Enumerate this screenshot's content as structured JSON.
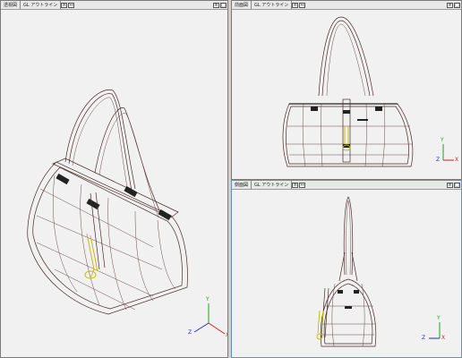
{
  "viewports": [
    {
      "label_a": "透視図",
      "label_b": "GL アウトライン"
    },
    {
      "label_a": "前面図",
      "label_b": "GL アウトライン"
    },
    {
      "label_a": "側面図",
      "label_b": "GL アウトライン"
    }
  ],
  "axis": {
    "x": "X",
    "y": "Y",
    "z": "Z"
  },
  "colors": {
    "x_axis": "#d02020",
    "y_axis": "#20a020",
    "z_axis": "#2030c0",
    "wire": "#4a2a2a",
    "accent": "#c9b400"
  }
}
